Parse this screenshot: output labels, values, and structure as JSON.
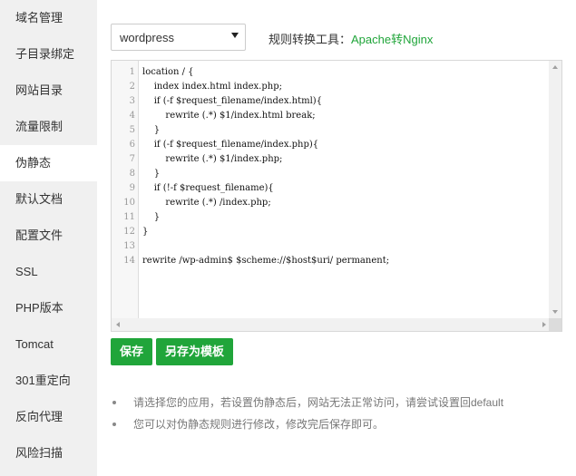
{
  "sidebar": {
    "items": [
      {
        "label": "域名管理"
      },
      {
        "label": "子目录绑定"
      },
      {
        "label": "网站目录"
      },
      {
        "label": "流量限制"
      },
      {
        "label": "伪静态"
      },
      {
        "label": "默认文档"
      },
      {
        "label": "配置文件"
      },
      {
        "label": "SSL"
      },
      {
        "label": "PHP版本"
      },
      {
        "label": "Tomcat"
      },
      {
        "label": "301重定向"
      },
      {
        "label": "反向代理"
      },
      {
        "label": "风险扫描"
      }
    ],
    "active_index": 4
  },
  "template_select": {
    "value": "wordpress"
  },
  "tool": {
    "label": "规则转换工具：",
    "link": "Apache转Nginx"
  },
  "editor": {
    "line_numbers": [
      "1",
      "2",
      "3",
      "4",
      "5",
      "6",
      "7",
      "8",
      "9",
      "10",
      "11",
      "12",
      "13",
      "14"
    ],
    "lines": [
      "location / {",
      "    index index.html index.php;",
      "    if (-f $request_filename/index.html){",
      "        rewrite (.*) $1/index.html break;",
      "    }",
      "    if (-f $request_filename/index.php){",
      "        rewrite (.*) $1/index.php;",
      "    }",
      "    if (!-f $request_filename){",
      "        rewrite (.*) /index.php;",
      "    }",
      "}",
      "",
      "rewrite /wp-admin$ $scheme://$host$uri/ permanent;"
    ]
  },
  "buttons": {
    "save": "保存",
    "save_as_template": "另存为模板"
  },
  "tips": [
    "请选择您的应用，若设置伪静态后，网站无法正常访问，请尝试设置回default",
    "您可以对伪静态规则进行修改，修改完后保存即可。"
  ],
  "colors": {
    "accent": "#20a53a",
    "sidebar_bg": "#f0f0f0"
  }
}
